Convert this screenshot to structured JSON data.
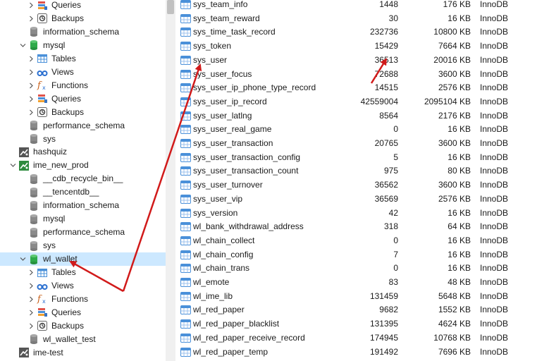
{
  "tree": [
    {
      "label": "Queries",
      "icon": "queries-icon",
      "depth": 2,
      "chevron": ">"
    },
    {
      "label": "Backups",
      "icon": "backups-icon",
      "depth": 2,
      "chevron": ">"
    },
    {
      "label": "information_schema",
      "icon": "database-gray-icon",
      "depth": 1,
      "chevron": ""
    },
    {
      "label": "mysql",
      "icon": "database-green-icon",
      "depth": 1,
      "chevron": "v"
    },
    {
      "label": "Tables",
      "icon": "tables-icon",
      "depth": 2,
      "chevron": ">"
    },
    {
      "label": "Views",
      "icon": "views-icon",
      "depth": 2,
      "chevron": ">"
    },
    {
      "label": "Functions",
      "icon": "functions-icon",
      "depth": 2,
      "chevron": ">"
    },
    {
      "label": "Queries",
      "icon": "queries-icon",
      "depth": 2,
      "chevron": ">"
    },
    {
      "label": "Backups",
      "icon": "backups-icon",
      "depth": 2,
      "chevron": ">"
    },
    {
      "label": "performance_schema",
      "icon": "database-gray-icon",
      "depth": 1,
      "chevron": ""
    },
    {
      "label": "sys",
      "icon": "database-gray-icon",
      "depth": 1,
      "chevron": ""
    },
    {
      "label": "hashquiz",
      "icon": "connection-gray-icon",
      "depth": 0,
      "chevron": ""
    },
    {
      "label": "ime_new_prod",
      "icon": "connection-green-icon",
      "depth": 0,
      "chevron": "v"
    },
    {
      "label": "__cdb_recycle_bin__",
      "icon": "database-gray-icon",
      "depth": 1,
      "chevron": ""
    },
    {
      "label": "__tencentdb__",
      "icon": "database-gray-icon",
      "depth": 1,
      "chevron": ""
    },
    {
      "label": "information_schema",
      "icon": "database-gray-icon",
      "depth": 1,
      "chevron": ""
    },
    {
      "label": "mysql",
      "icon": "database-gray-icon",
      "depth": 1,
      "chevron": ""
    },
    {
      "label": "performance_schema",
      "icon": "database-gray-icon",
      "depth": 1,
      "chevron": ""
    },
    {
      "label": "sys",
      "icon": "database-gray-icon",
      "depth": 1,
      "chevron": ""
    },
    {
      "label": "wl_wallet",
      "icon": "database-green-icon",
      "depth": 1,
      "chevron": "v",
      "selected": true
    },
    {
      "label": "Tables",
      "icon": "tables-icon",
      "depth": 2,
      "chevron": ">"
    },
    {
      "label": "Views",
      "icon": "views-icon",
      "depth": 2,
      "chevron": ">"
    },
    {
      "label": "Functions",
      "icon": "functions-icon",
      "depth": 2,
      "chevron": ">"
    },
    {
      "label": "Queries",
      "icon": "queries-icon",
      "depth": 2,
      "chevron": ">"
    },
    {
      "label": "Backups",
      "icon": "backups-icon",
      "depth": 2,
      "chevron": ">"
    },
    {
      "label": "wl_wallet_test",
      "icon": "database-gray-icon",
      "depth": 1,
      "chevron": ""
    },
    {
      "label": "ime-test",
      "icon": "connection-gray-icon",
      "depth": 0,
      "chevron": ""
    }
  ],
  "tables": [
    {
      "name": "sys_team_info",
      "rows": "1448",
      "size": "176 KB",
      "engine": "InnoDB"
    },
    {
      "name": "sys_team_reward",
      "rows": "30",
      "size": "16 KB",
      "engine": "InnoDB"
    },
    {
      "name": "sys_time_task_record",
      "rows": "232736",
      "size": "10800 KB",
      "engine": "InnoDB"
    },
    {
      "name": "sys_token",
      "rows": "15429",
      "size": "7664 KB",
      "engine": "InnoDB"
    },
    {
      "name": "sys_user",
      "rows": "36513",
      "size": "20016 KB",
      "engine": "InnoDB"
    },
    {
      "name": "sys_user_focus",
      "rows": "72688",
      "size": "3600 KB",
      "engine": "InnoDB"
    },
    {
      "name": "sys_user_ip_phone_type_record",
      "rows": "14515",
      "size": "2576 KB",
      "engine": "InnoDB"
    },
    {
      "name": "sys_user_ip_record",
      "rows": "42559004",
      "size": "2095104 KB",
      "engine": "InnoDB"
    },
    {
      "name": "sys_user_latlng",
      "rows": "8564",
      "size": "2176 KB",
      "engine": "InnoDB"
    },
    {
      "name": "sys_user_real_game",
      "rows": "0",
      "size": "16 KB",
      "engine": "InnoDB"
    },
    {
      "name": "sys_user_transaction",
      "rows": "20765",
      "size": "3600 KB",
      "engine": "InnoDB"
    },
    {
      "name": "sys_user_transaction_config",
      "rows": "5",
      "size": "16 KB",
      "engine": "InnoDB"
    },
    {
      "name": "sys_user_transaction_count",
      "rows": "975",
      "size": "80 KB",
      "engine": "InnoDB"
    },
    {
      "name": "sys_user_turnover",
      "rows": "36562",
      "size": "3600 KB",
      "engine": "InnoDB"
    },
    {
      "name": "sys_user_vip",
      "rows": "36569",
      "size": "2576 KB",
      "engine": "InnoDB"
    },
    {
      "name": "sys_version",
      "rows": "42",
      "size": "16 KB",
      "engine": "InnoDB"
    },
    {
      "name": "wl_bank_withdrawal_address",
      "rows": "318",
      "size": "64 KB",
      "engine": "InnoDB"
    },
    {
      "name": "wl_chain_collect",
      "rows": "0",
      "size": "16 KB",
      "engine": "InnoDB"
    },
    {
      "name": "wl_chain_config",
      "rows": "7",
      "size": "16 KB",
      "engine": "InnoDB"
    },
    {
      "name": "wl_chain_trans",
      "rows": "0",
      "size": "16 KB",
      "engine": "InnoDB"
    },
    {
      "name": "wl_emote",
      "rows": "83",
      "size": "48 KB",
      "engine": "InnoDB"
    },
    {
      "name": "wl_ime_lib",
      "rows": "131459",
      "size": "5648 KB",
      "engine": "InnoDB"
    },
    {
      "name": "wl_red_paper",
      "rows": "9682",
      "size": "1552 KB",
      "engine": "InnoDB"
    },
    {
      "name": "wl_red_paper_blacklist",
      "rows": "131395",
      "size": "4624 KB",
      "engine": "InnoDB"
    },
    {
      "name": "wl_red_paper_receive_record",
      "rows": "174945",
      "size": "10768 KB",
      "engine": "InnoDB"
    },
    {
      "name": "wl_red_paper_temp",
      "rows": "191492",
      "size": "7696 KB",
      "engine": "InnoDB"
    }
  ],
  "colors": {
    "selected_row": "#cce8ff",
    "annotation_arrow": "#d11a1a",
    "table_icon": "#4a90d9",
    "db_green": "#2eaa4a",
    "db_gray": "#8a8a8a"
  }
}
